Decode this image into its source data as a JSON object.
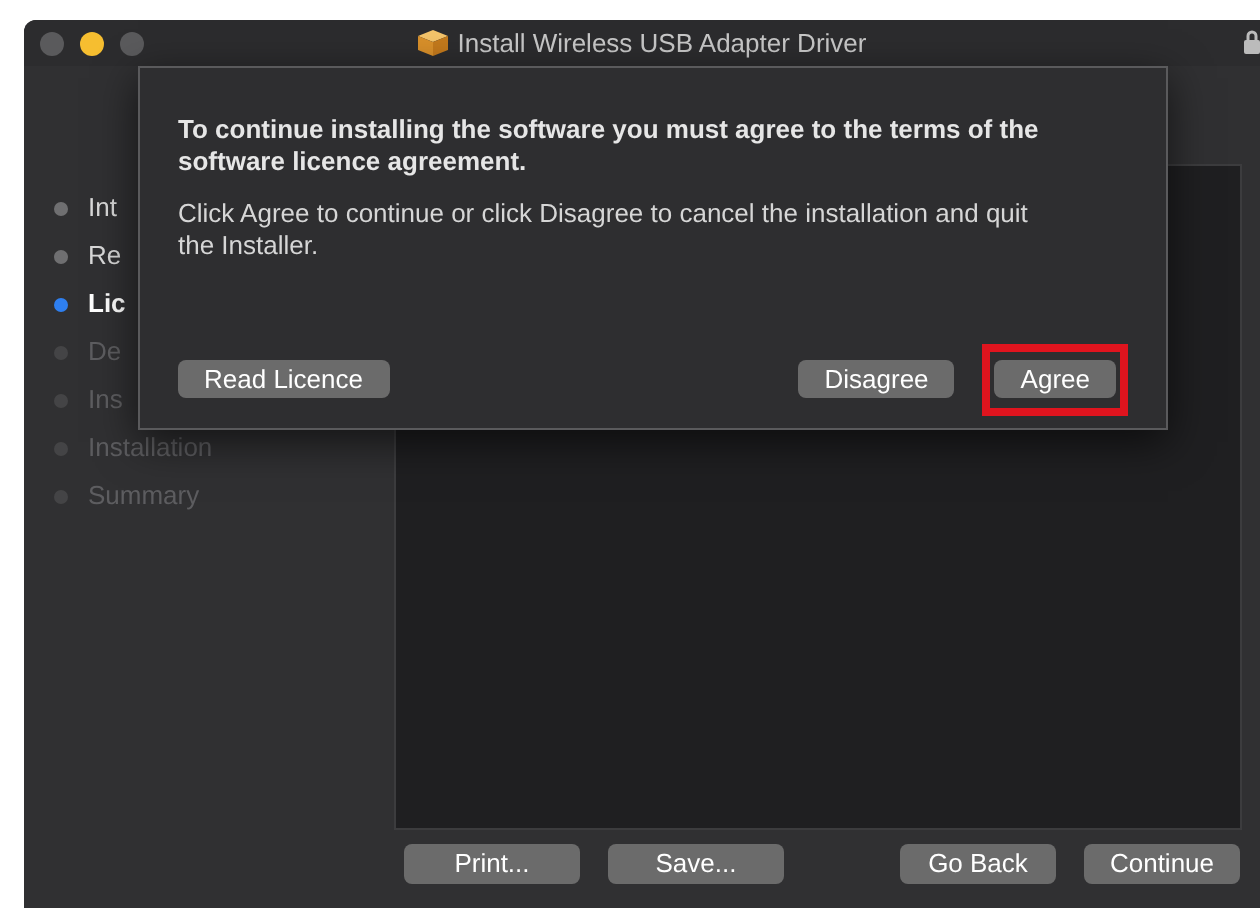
{
  "window": {
    "title": "Install Wireless USB Adapter Driver"
  },
  "sidebar": {
    "items": [
      {
        "label": "Int",
        "selected": false,
        "disabled": false
      },
      {
        "label": "Re",
        "selected": false,
        "disabled": false
      },
      {
        "label": "Lic",
        "selected": true,
        "disabled": false
      },
      {
        "label": "De",
        "selected": false,
        "disabled": true
      },
      {
        "label": "Ins",
        "selected": false,
        "disabled": true
      },
      {
        "label": "Installation",
        "selected": false,
        "disabled": true
      },
      {
        "label": "Summary",
        "selected": false,
        "disabled": true
      }
    ]
  },
  "footer_buttons": [
    "Print...",
    "Save...",
    "Go Back",
    "Continue"
  ],
  "sheet": {
    "title": "To continue installing the software you must agree to the terms of the software licence agreement.",
    "message": "Click Agree to continue or click Disagree to cancel the installation and quit the Installer.",
    "buttons": [
      {
        "label": "Read Licence",
        "highlighted": false
      },
      {
        "label": "Disagree",
        "highlighted": false
      },
      {
        "label": "Agree",
        "highlighted": true
      }
    ]
  }
}
